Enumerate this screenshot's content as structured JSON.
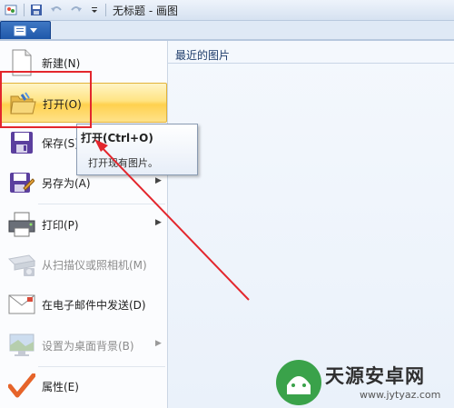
{
  "window": {
    "title": "无标题 - 画图"
  },
  "right_pane": {
    "heading": "最近的图片"
  },
  "menu": {
    "items": [
      {
        "label": "新建(N)",
        "icon": "new-document-icon",
        "disabled": false,
        "submenu": false
      },
      {
        "label": "打开(O)",
        "icon": "open-folder-icon",
        "disabled": false,
        "submenu": false,
        "highlighted": true
      },
      {
        "label": "保存(S)",
        "icon": "save-floppy-icon",
        "disabled": false,
        "submenu": false
      },
      {
        "label": "另存为(A)",
        "icon": "save-as-icon",
        "disabled": false,
        "submenu": true
      },
      {
        "label": "打印(P)",
        "icon": "printer-icon",
        "disabled": false,
        "submenu": true
      },
      {
        "label": "从扫描仪或照相机(M)",
        "icon": "scanner-icon",
        "disabled": true,
        "submenu": false
      },
      {
        "label": "在电子邮件中发送(D)",
        "icon": "email-icon",
        "disabled": false,
        "submenu": false
      },
      {
        "label": "设置为桌面背景(B)",
        "icon": "desktop-background-icon",
        "disabled": true,
        "submenu": true
      },
      {
        "label": "属性(E)",
        "icon": "properties-check-icon",
        "disabled": false,
        "submenu": false
      }
    ]
  },
  "tooltip": {
    "title": "打开(Ctrl+O)",
    "description": "打开现有图片。"
  },
  "watermark": {
    "name": "天源安卓网",
    "url": "www.jytyaz.com"
  },
  "colors": {
    "annotation": "#e3262d",
    "highlight": "#ffd14f",
    "menu_button": "#1d56a8"
  }
}
